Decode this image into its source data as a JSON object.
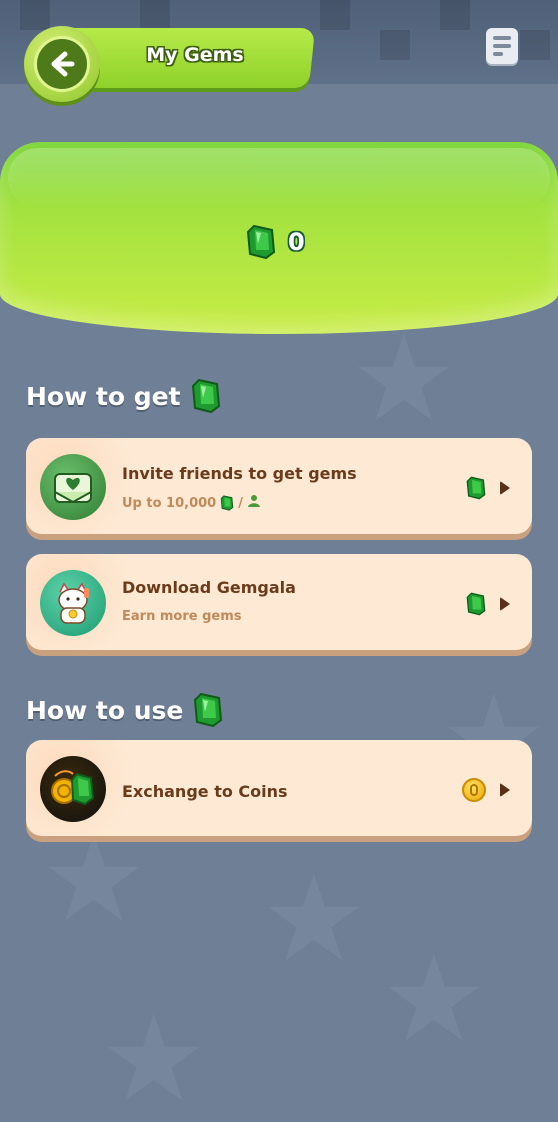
{
  "header": {
    "title": "My Gems",
    "back_icon": "back-arrow-icon",
    "menu_icon": "document-list-icon"
  },
  "balance": {
    "value": "0",
    "icon": "green-gem-icon"
  },
  "how_to_get": {
    "title": "How to get",
    "items": [
      {
        "title": "Invite friends to get gems",
        "subtitle_prefix": "Up to 10,000",
        "subtitle_suffix": "/",
        "icon": "invite-envelope-icon",
        "reward_icon": "green-gem-icon"
      },
      {
        "title": "Download Gemgala",
        "subtitle": "Earn more gems",
        "icon": "lucky-cat-icon",
        "reward_icon": "green-gem-icon"
      }
    ]
  },
  "how_to_use": {
    "title": "How to use",
    "items": [
      {
        "title": "Exchange to Coins",
        "icon": "gem-exchange-icon",
        "reward_icon": "gold-coin-icon"
      }
    ]
  },
  "colors": {
    "background": "#6e7f96",
    "accent_green": "#8fd12a",
    "card": "#fde9d4",
    "text_brown": "#6b3c1c"
  }
}
